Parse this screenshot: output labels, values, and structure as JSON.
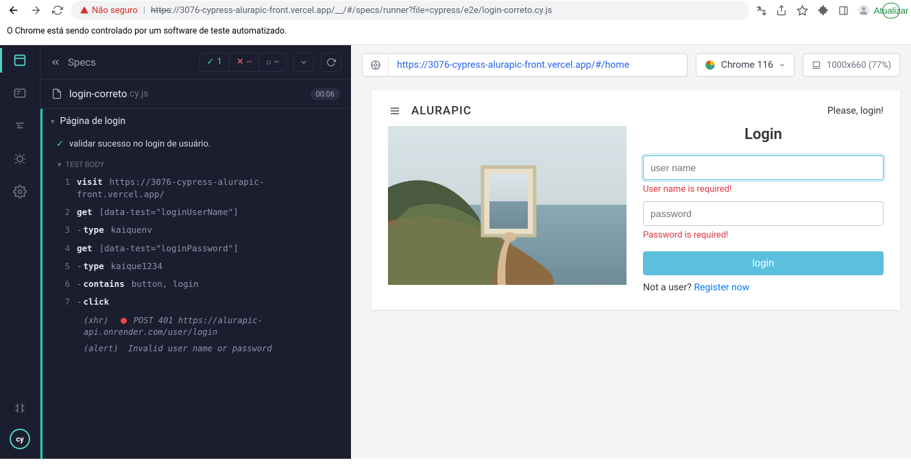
{
  "browser": {
    "not_secure": "Não seguro",
    "url_proto": "https",
    "url_rest": "://3076-cypress-alurapic-front.vercel.app/__/#/specs/runner?file=cypress/e2e/login-correto.cy.js",
    "update_btn": "Atualizar"
  },
  "automation_msg": "O Chrome está sendo controlado por um software de teste automatizado.",
  "sidebar": {
    "title": "Specs",
    "pass_count": "1",
    "fail_count": "--",
    "pending_count": "--"
  },
  "file": {
    "name": "login-correto",
    "ext": ".cy.js",
    "time": "00:06"
  },
  "test": {
    "describe": "Página de login",
    "it": "validar sucesso no login de usuário.",
    "body_label": "TEST BODY"
  },
  "cmds": [
    {
      "n": "1",
      "name": "visit",
      "arg": "https://3076-cypress-alurapic-front.vercel.app/"
    },
    {
      "n": "2",
      "name": "get",
      "arg": "[data-test=\"loginUserName\"]"
    },
    {
      "n": "3",
      "dash": true,
      "name": "type",
      "arg": "kaiquenv"
    },
    {
      "n": "4",
      "name": "get",
      "arg": "[data-test=\"loginPassword\"]"
    },
    {
      "n": "5",
      "dash": true,
      "name": "type",
      "arg": "kaique1234"
    },
    {
      "n": "6",
      "dash": true,
      "name": "contains",
      "arg": "button, login"
    },
    {
      "n": "7",
      "dash": true,
      "name": "click",
      "arg": ""
    }
  ],
  "xhr": {
    "tag": "(xhr)",
    "method": "POST 401",
    "url": "https://alurapic-api.onrender.com/user/login"
  },
  "alert": {
    "tag": "(alert)",
    "msg": "Invalid user name or password"
  },
  "aut": {
    "url": "https://3076-cypress-alurapic-front.vercel.app/#/home",
    "browser": "Chrome 116",
    "viewport": "1000x660 (77%)"
  },
  "app": {
    "brand": "ALURAPIC",
    "please": "Please, login!",
    "login_heading": "Login",
    "username_ph": "user name",
    "username_err": "User name is required!",
    "password_ph": "password",
    "password_err": "Password is required!",
    "login_btn": "login",
    "not_user": "Not a user? ",
    "register": "Register now"
  }
}
